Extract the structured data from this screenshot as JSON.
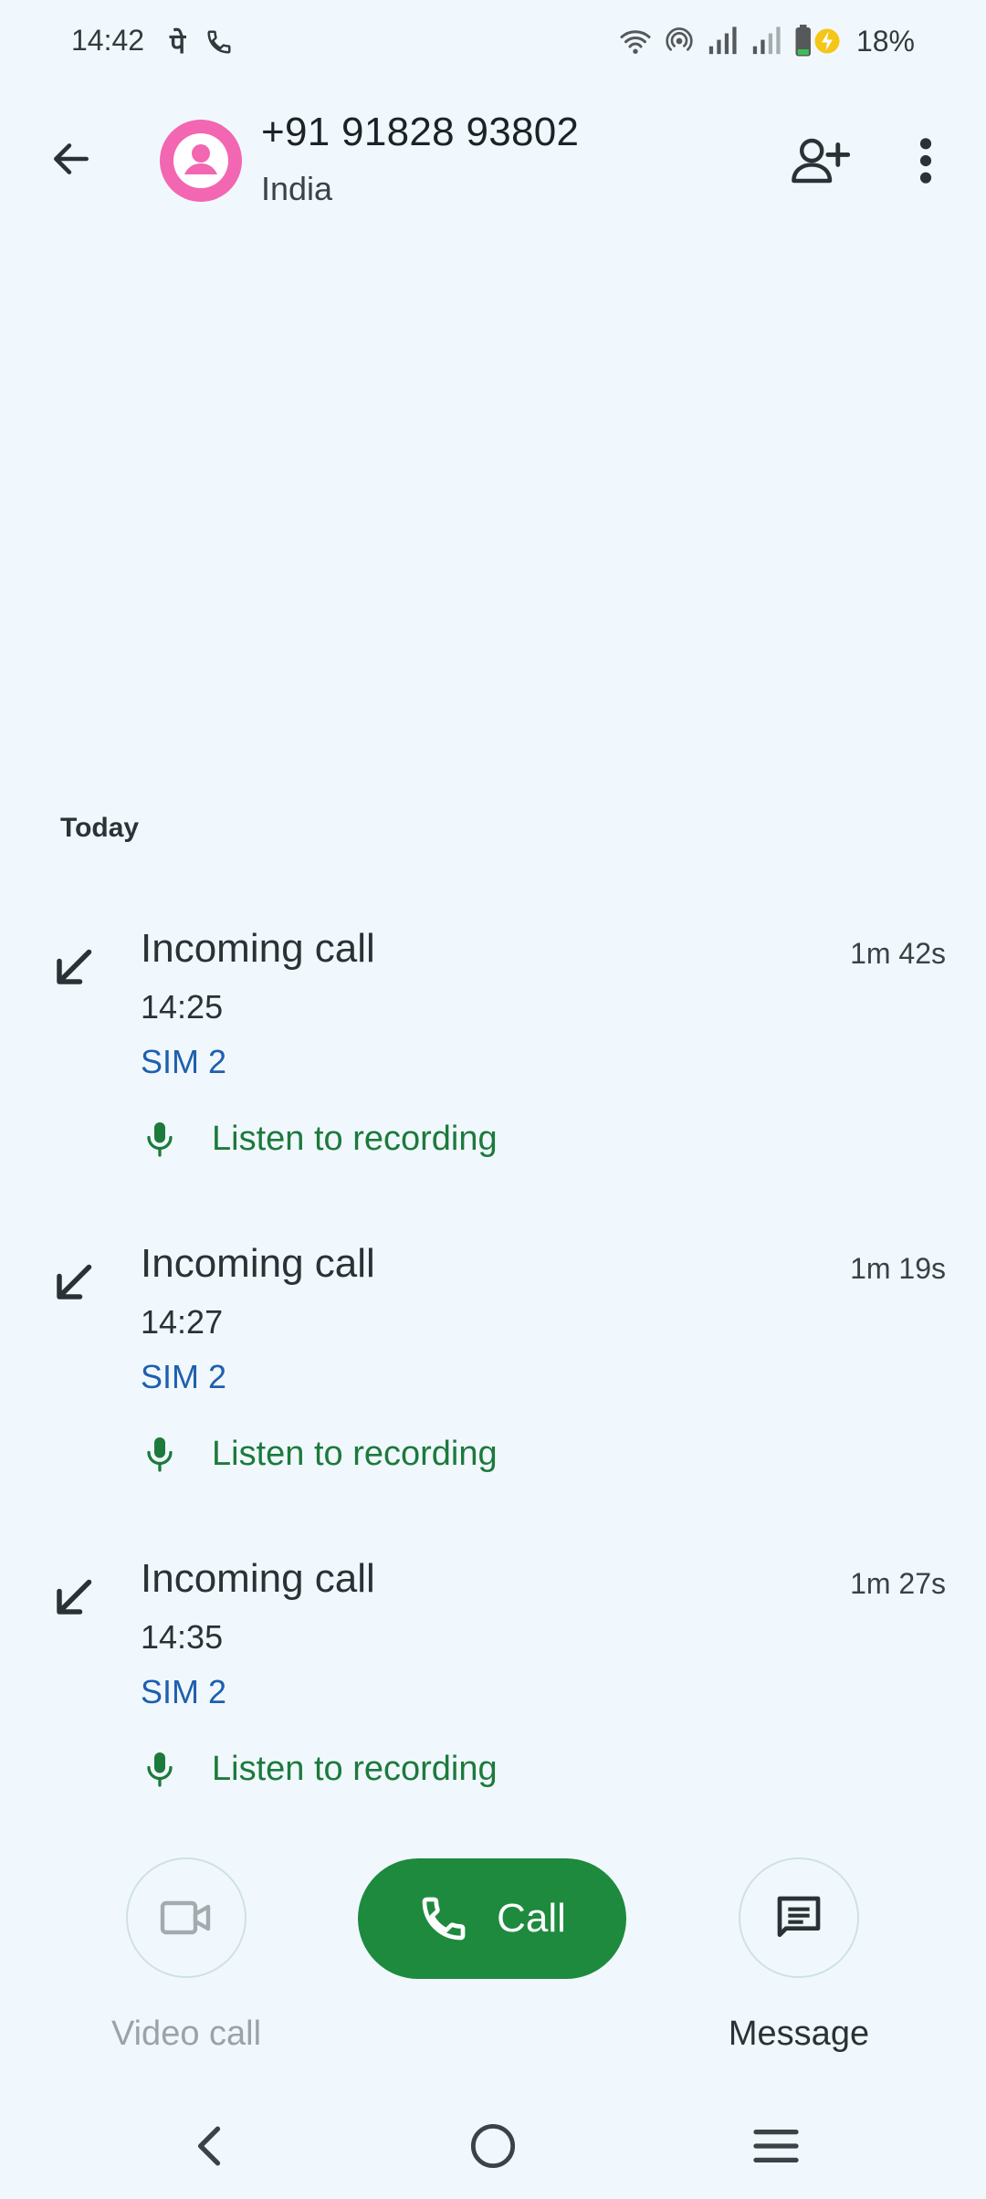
{
  "status_bar": {
    "time": "14:42",
    "left_icons": [
      "payment-icon",
      "phone-call-icon"
    ],
    "right_icons": [
      "wifi-icon",
      "hotspot-icon",
      "signal-sim1-icon",
      "signal-sim2-icon",
      "battery-charging-icon"
    ],
    "battery_percent": "18%"
  },
  "header": {
    "contact_number": "+91 91828 93802",
    "contact_country": "India",
    "avatar_color": "#f266b2"
  },
  "history": {
    "section_label": "Today",
    "calls": [
      {
        "type": "Incoming call",
        "time": "14:25",
        "sim": "SIM 2",
        "duration": "1m 42s",
        "recording_label": "Listen to recording"
      },
      {
        "type": "Incoming call",
        "time": "14:27",
        "sim": "SIM 2",
        "duration": "1m 19s",
        "recording_label": "Listen to recording"
      },
      {
        "type": "Incoming call",
        "time": "14:35",
        "sim": "SIM 2",
        "duration": "1m 27s",
        "recording_label": "Listen to recording"
      }
    ]
  },
  "actions": {
    "video_call_label": "Video call",
    "call_label": "Call",
    "message_label": "Message",
    "call_color": "#1e8a3e"
  },
  "nav": [
    "back-nav-icon",
    "home-nav-icon",
    "recents-nav-icon"
  ]
}
